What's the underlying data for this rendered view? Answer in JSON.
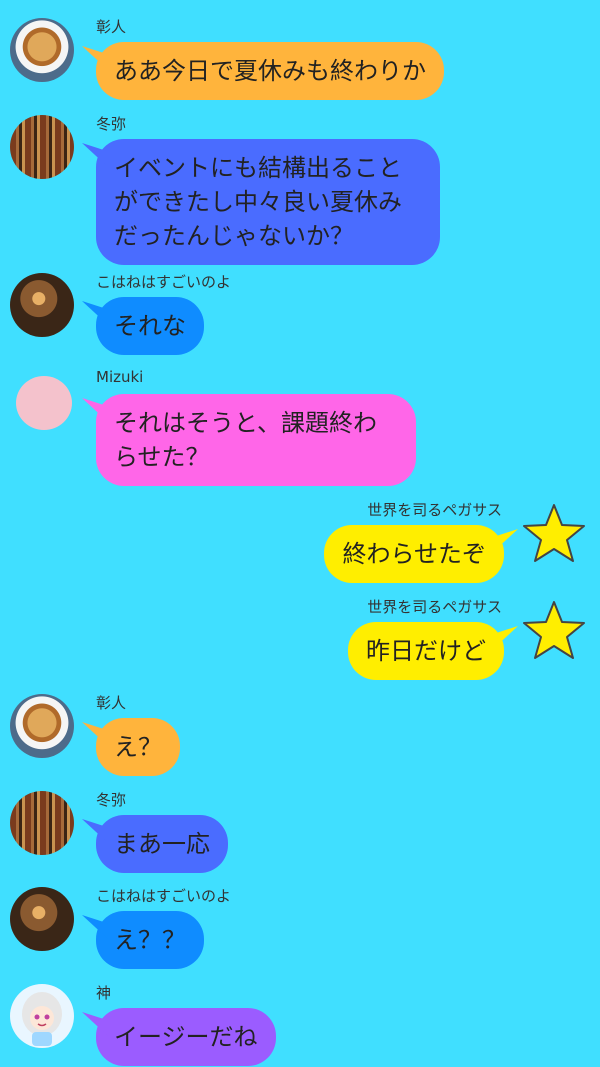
{
  "messages": [
    {
      "side": "left",
      "sender": "彰人",
      "text": "ああ今日で夏休みも終わりか",
      "color": "#ffb43c",
      "avatar": "pancake-avatar"
    },
    {
      "side": "left",
      "sender": "冬弥",
      "text": "イベントにも結構出ることができたし中々良い夏休みだったんじゃないか？",
      "color": "#4a6cff",
      "avatar": "bookshelf-avatar"
    },
    {
      "side": "left",
      "sender": "こはねはすごいのよ",
      "text": "それな",
      "color": "#0f8cff",
      "avatar": "cafe-avatar"
    },
    {
      "side": "left",
      "sender": "Mizuki",
      "text": "それはそうと、課題終わらせた？",
      "color": "#ff66e8",
      "avatar": "pink-circle-avatar"
    },
    {
      "side": "right",
      "sender": "世界を司るペガサス",
      "text": "終わらせたぞ",
      "color": "#ffee00",
      "avatar": "star-icon"
    },
    {
      "side": "right",
      "sender": "世界を司るペガサス",
      "text": "昨日だけど",
      "color": "#ffee00",
      "avatar": "star-icon"
    },
    {
      "side": "left",
      "sender": "彰人",
      "text": "え？",
      "color": "#ffb43c",
      "avatar": "pancake-avatar"
    },
    {
      "side": "left",
      "sender": "冬弥",
      "text": "まあ一応",
      "color": "#4a6cff",
      "avatar": "bookshelf-avatar"
    },
    {
      "side": "left",
      "sender": "こはねはすごいのよ",
      "text": "え？？",
      "color": "#0f8cff",
      "avatar": "cafe-avatar"
    },
    {
      "side": "left",
      "sender": "神",
      "text": "イージーだね",
      "color": "#9b5cff",
      "avatar": "anime-character-avatar"
    }
  ]
}
